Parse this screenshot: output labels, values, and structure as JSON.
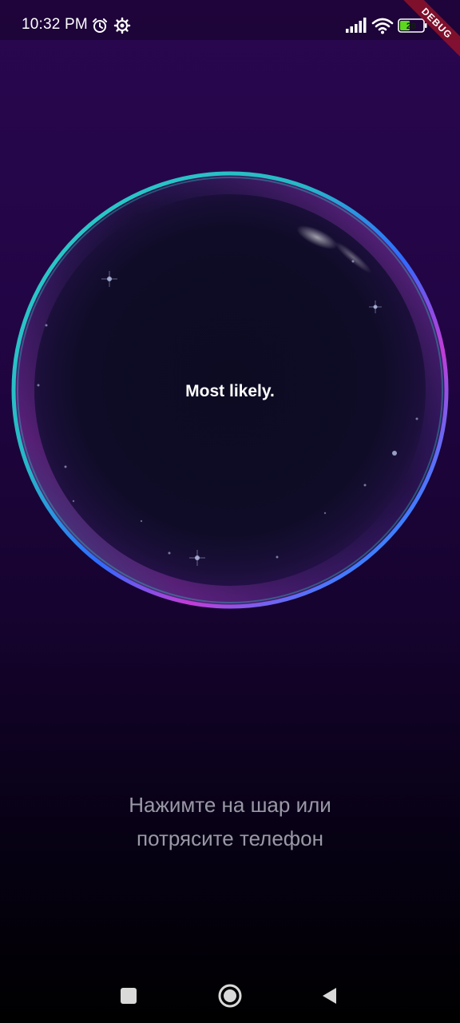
{
  "status_bar": {
    "time": "10:32 PM",
    "icons": [
      "alarm-icon",
      "settings-icon",
      "signal-icon",
      "wifi-icon",
      "battery-icon"
    ],
    "battery_level": "28",
    "battery_color": "#5cd61f"
  },
  "debug_banner": {
    "label": "DEBUG",
    "color": "#a01428"
  },
  "ball": {
    "answer": "Most likely.",
    "rim_colors": [
      "#2ad1c8",
      "#2f6bff",
      "#c23cd6"
    ]
  },
  "hint": {
    "line1": "Нажимте на шар или",
    "line2": "потрясите телефон"
  },
  "nav_bar": {
    "buttons": [
      "recents-button",
      "home-button",
      "back-button"
    ]
  }
}
